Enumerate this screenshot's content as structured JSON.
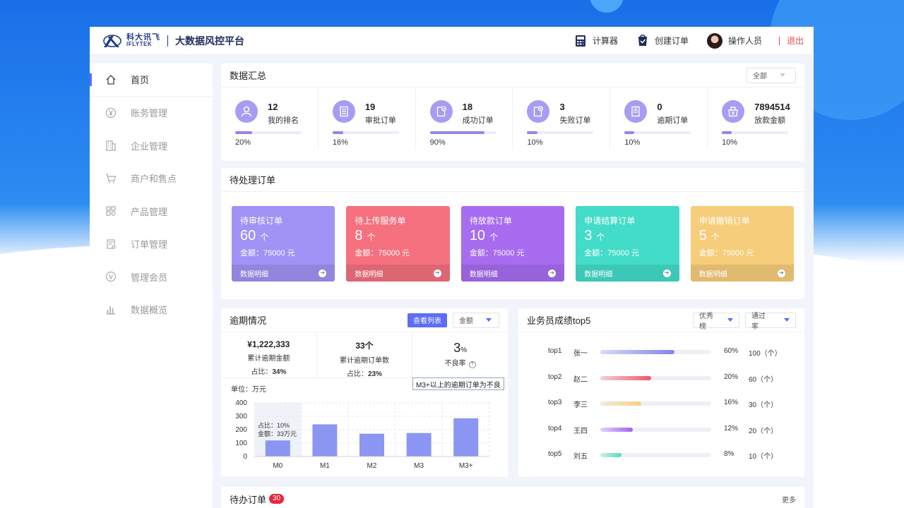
{
  "header": {
    "logo_cn": "科大讯飞",
    "logo_en": "IFLYTEK",
    "platform_title": "大数据风控平台",
    "calculator_label": "计算器",
    "create_order_label": "创建订单",
    "operator_label": "操作人员",
    "logout_label": "退出"
  },
  "sidebar": {
    "items": [
      {
        "label": "首页",
        "icon": "home-icon"
      },
      {
        "label": "账务管理",
        "icon": "yen-icon"
      },
      {
        "label": "企业管理",
        "icon": "building-icon"
      },
      {
        "label": "商户和售点",
        "icon": "cart-icon"
      },
      {
        "label": "产品管理",
        "icon": "grid-icon"
      },
      {
        "label": "订单管理",
        "icon": "order-icon"
      },
      {
        "label": "管理会员",
        "icon": "vip-icon"
      },
      {
        "label": "数据概览",
        "icon": "bar-chart-icon"
      }
    ]
  },
  "summary": {
    "title": "数据汇总",
    "filter": "全部",
    "stats": [
      {
        "value": "12",
        "label": "我的排名",
        "pct": "20%",
        "fill": 0.25
      },
      {
        "value": "19",
        "label": "审批订单",
        "pct": "16%",
        "fill": 0.16
      },
      {
        "value": "18",
        "label": "成功订单",
        "pct": "90%",
        "fill": 0.82
      },
      {
        "value": "3",
        "label": "失败订单",
        "pct": "10%",
        "fill": 0.15
      },
      {
        "value": "0",
        "label": "逾期订单",
        "pct": "10%",
        "fill": 0.15
      },
      {
        "value": "7894514",
        "label": "放款金额",
        "pct": "10%",
        "fill": 0.15
      }
    ]
  },
  "pending": {
    "title": "待处理订单",
    "cards": [
      {
        "title": "待审核订单",
        "count": "60",
        "unit": "个",
        "amount": "金额：75000 元",
        "detail": "数据明细",
        "color": "#a093f5"
      },
      {
        "title": "待上传服务单",
        "count": "8",
        "unit": "个",
        "amount": "金额：75000 元",
        "detail": "数据明细",
        "color": "#f5717f"
      },
      {
        "title": "待放款订单",
        "count": "10",
        "unit": "个",
        "amount": "金额：75000 元",
        "detail": "数据明细",
        "color": "#a76cf0"
      },
      {
        "title": "申请结算订单",
        "count": "3",
        "unit": "个",
        "amount": "金额：75000 元",
        "detail": "数据明细",
        "color": "#43dcc8"
      },
      {
        "title": "申请撤销订单",
        "count": "5",
        "unit": "个",
        "amount": "金额：75000 元",
        "detail": "数据明细",
        "color": "#f6cd7a"
      }
    ]
  },
  "overdue": {
    "title": "逾期情况",
    "view_list": "查看列表",
    "filter": "金额",
    "cells": [
      {
        "big": "¥1,222,333",
        "label": "累计逾期金额",
        "ratio_label": "占比：",
        "ratio": "34%"
      },
      {
        "big": "33个",
        "label": "累计逾期订单数",
        "ratio_label": "占比：",
        "ratio": "23%"
      }
    ],
    "rate_value": "3",
    "rate_unit": "%",
    "rate_label": "不良率",
    "tooltip": "M3+以上的逾期订单为不良",
    "unit_label": "单位：万元",
    "hover": {
      "ratio": "占比：10%",
      "amount": "金额：33万元"
    }
  },
  "chart_data": {
    "type": "bar",
    "categories": [
      "M0",
      "M1",
      "M2",
      "M3",
      "M3+"
    ],
    "values": [
      120,
      240,
      170,
      175,
      285
    ],
    "ylabel": "单位：万元",
    "ylim": [
      0,
      400
    ],
    "yticks": [
      0,
      100,
      200,
      300,
      400
    ],
    "bar_color": "#8b96f3"
  },
  "top5": {
    "title": "业务员成绩top5",
    "filter1": "优秀榜",
    "filter2": "通过率",
    "rows": [
      {
        "rank": "top1",
        "name": "张一",
        "pct": "60%",
        "count": "100（个）",
        "fill": 0.67,
        "color": "#7d86f0"
      },
      {
        "rank": "top2",
        "name": "赵二",
        "pct": "20%",
        "count": "60（个）",
        "fill": 0.46,
        "color": "#f0576b"
      },
      {
        "rank": "top3",
        "name": "李三",
        "pct": "16%",
        "count": "30（个）",
        "fill": 0.37,
        "color": "#f7cf84"
      },
      {
        "rank": "top4",
        "name": "王四",
        "pct": "12%",
        "count": "20（个）",
        "fill": 0.29,
        "color": "#a364ec"
      },
      {
        "rank": "top5",
        "name": "刘五",
        "pct": "8%",
        "count": "10（个）",
        "fill": 0.19,
        "color": "#55dcc4"
      }
    ]
  },
  "todo": {
    "title": "待办订单",
    "badge": "30",
    "more": "更多"
  }
}
